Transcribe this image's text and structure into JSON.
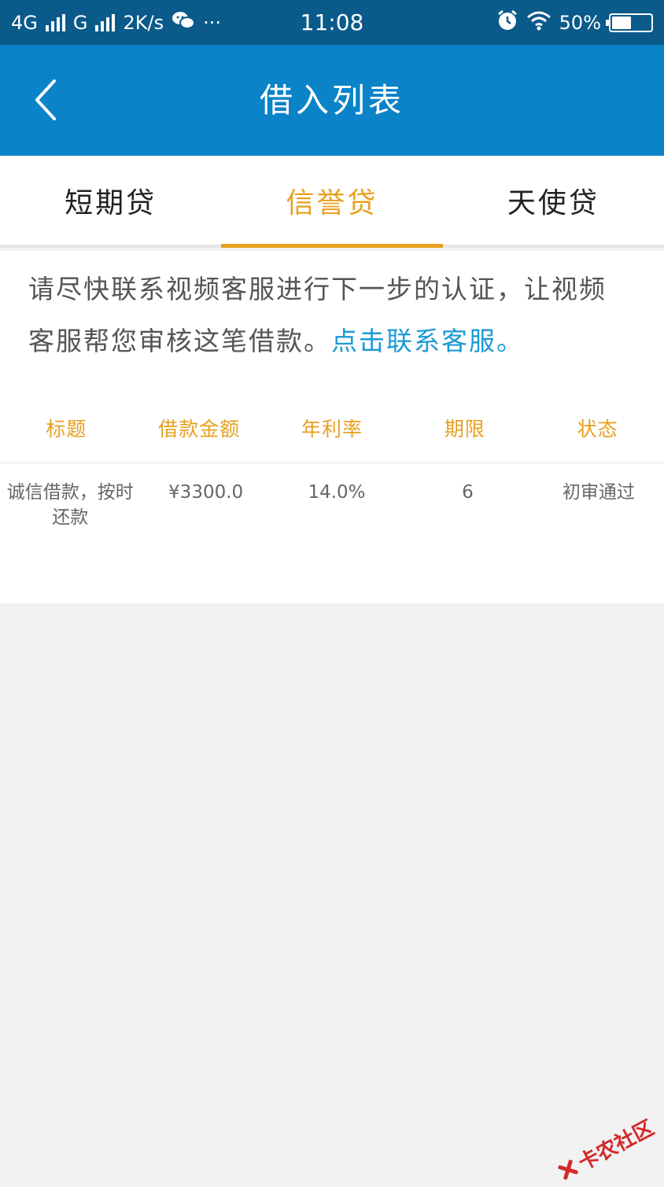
{
  "status_bar": {
    "network1": "4G",
    "network2": "G",
    "speed": "2K/s",
    "more": "···",
    "time": "11:08",
    "battery_text": "50%",
    "battery_level": 0.5
  },
  "header": {
    "title": "借入列表"
  },
  "tabs": [
    {
      "label": "短期贷"
    },
    {
      "label": "信誉贷"
    },
    {
      "label": "天使贷"
    }
  ],
  "notice": {
    "text": "请尽快联系视频客服进行下一步的认证，让视频客服帮您审核这笔借款。",
    "link": "点击联系客服。"
  },
  "table": {
    "headers": [
      "标题",
      "借款金额",
      "年利率",
      "期限",
      "状态"
    ],
    "rows": [
      [
        "诚信借款，按时还款",
        "¥3300.0",
        "14.0%",
        "6",
        "初审通过"
      ]
    ]
  },
  "watermark": {
    "text": "卡农社区"
  },
  "colors": {
    "status_bar": "#0a5a8a",
    "header": "#0a83c9",
    "accent": "#e8a01f",
    "link": "#1a9ad6"
  }
}
